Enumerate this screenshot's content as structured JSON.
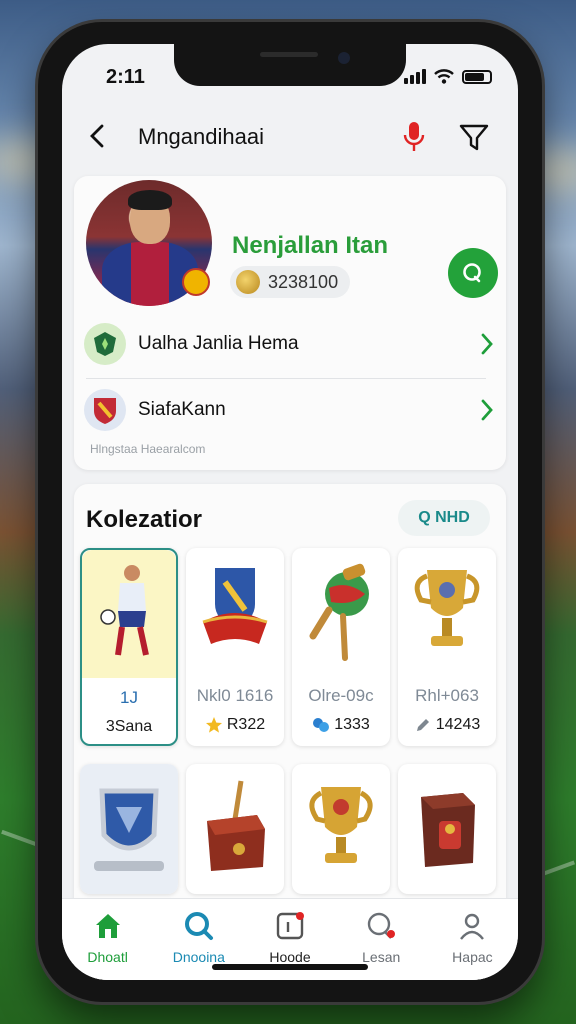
{
  "status_bar": {
    "time": "2:11"
  },
  "header": {
    "title": "Mngandihaai"
  },
  "profile": {
    "name": "Nenjallan Itan",
    "coins": "3238100",
    "menu": [
      {
        "label": "Ualha Janlia Hema",
        "icon": "shield-badge-icon"
      },
      {
        "label": "SiafaKann",
        "icon": "club-crest-icon"
      }
    ],
    "footnote": "Hlngstaa Haearalcom"
  },
  "collection": {
    "title": "Kolezatior",
    "chip": "Q NHD",
    "items": [
      {
        "name": "1J",
        "stat": "3Sana",
        "icon": "player-card-icon"
      },
      {
        "name": "Nkl0 1616",
        "stat": "R322",
        "icon": "shield-banner-icon",
        "stat_icon": "star-icon"
      },
      {
        "name": "Olre-09c",
        "stat": "1333",
        "icon": "pipe-trophy-icon",
        "stat_icon": "gems-icon"
      },
      {
        "name": "Rhl+063",
        "stat": "14243",
        "icon": "golden-cup-icon",
        "stat_icon": "pencil-icon"
      }
    ],
    "items_row2": [
      {
        "icon": "crest-shield-icon"
      },
      {
        "icon": "treasure-box-icon"
      },
      {
        "icon": "trophy-cup-icon"
      },
      {
        "icon": "trophy-box-icon"
      }
    ]
  },
  "tabs": [
    {
      "label": "Dhoatl",
      "icon": "home-icon"
    },
    {
      "label": "Dnooina",
      "icon": "search-icon"
    },
    {
      "label": "Hoode",
      "icon": "card-notification-icon"
    },
    {
      "label": "Lesan",
      "icon": "chat-icon"
    },
    {
      "label": "Hapac",
      "icon": "profile-icon"
    }
  ],
  "colors": {
    "accent_green": "#23a23a",
    "teal": "#2c8f86"
  }
}
